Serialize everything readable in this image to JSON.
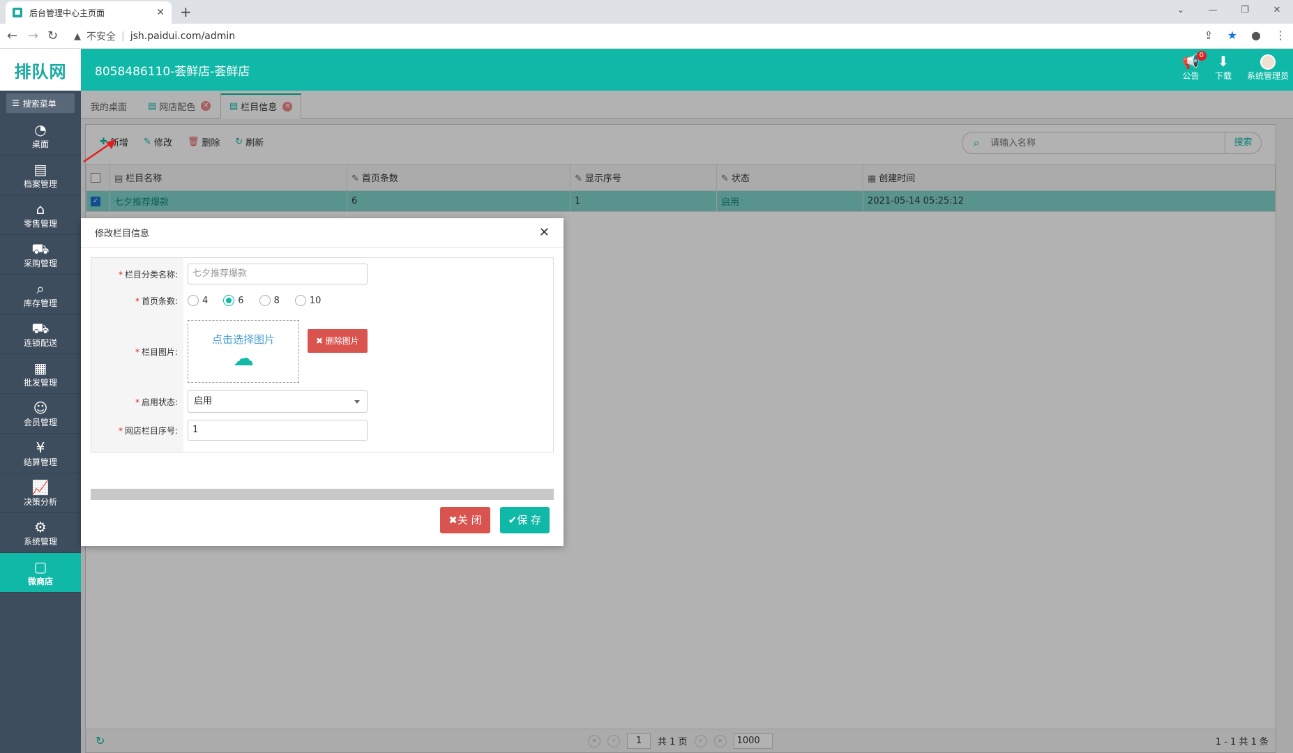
{
  "browser": {
    "tab_title": "后台管理中心主页面",
    "insecure_label": "不安全",
    "url": "jsh.paidui.com/admin"
  },
  "header": {
    "logo": "排队网",
    "store_name": "8058486110-荟鲜店-荟鲜店",
    "notice_label": "公告",
    "notice_count": "0",
    "download_label": "下载",
    "user_label": "系统管理员"
  },
  "sidebar": {
    "search_label": "搜索菜单",
    "items": [
      {
        "label": "桌面",
        "icon": "dashboard-icon"
      },
      {
        "label": "档案管理",
        "icon": "archive-icon"
      },
      {
        "label": "零售管理",
        "icon": "store-icon"
      },
      {
        "label": "采购管理",
        "icon": "cart-icon"
      },
      {
        "label": "库存管理",
        "icon": "inventory-icon"
      },
      {
        "label": "连锁配送",
        "icon": "truck-icon"
      },
      {
        "label": "批发管理",
        "icon": "wholesale-icon"
      },
      {
        "label": "会员管理",
        "icon": "member-icon"
      },
      {
        "label": "结算管理",
        "icon": "settlement-icon"
      },
      {
        "label": "决策分析",
        "icon": "chart-icon"
      },
      {
        "label": "系统管理",
        "icon": "gear-icon"
      },
      {
        "label": "微商店",
        "icon": "shop-icon"
      }
    ]
  },
  "content_tabs": [
    {
      "label": "我的桌面"
    },
    {
      "label": "网店配色"
    },
    {
      "label": "栏目信息"
    }
  ],
  "toolbar": {
    "add": "新增",
    "edit": "修改",
    "delete": "删除",
    "refresh": "刷新",
    "search_placeholder": "请输入名称",
    "search_button": "搜索"
  },
  "grid": {
    "columns": [
      "栏目名称",
      "首页条数",
      "显示序号",
      "状态",
      "创建时间"
    ],
    "rows": [
      {
        "name": "七夕推荐爆款",
        "count": "6",
        "order": "1",
        "status": "启用",
        "created": "2021-05-14 05:25:12"
      }
    ]
  },
  "pager": {
    "page": "1",
    "total_pages": "共 1 页",
    "page_size": "1000",
    "summary": "1 - 1   共 1 条"
  },
  "dialog": {
    "title": "修改栏目信息",
    "fields": {
      "name_label": "栏目分类名称:",
      "name_value": "七夕推荐爆款",
      "count_label": "首页条数:",
      "count_options": [
        "4",
        "6",
        "8",
        "10"
      ],
      "count_selected": "6",
      "image_label": "栏目图片:",
      "upload_text": "点击选择图片",
      "delete_image": "删除图片",
      "status_label": "启用状态:",
      "status_value": "启用",
      "order_label": "网店栏目序号:",
      "order_value": "1"
    },
    "close_button": "关 闭",
    "save_button": "保 存"
  },
  "colors": {
    "accent": "#10b8a8",
    "danger": "#d9534f",
    "sidebar": "#3e4d5d"
  }
}
